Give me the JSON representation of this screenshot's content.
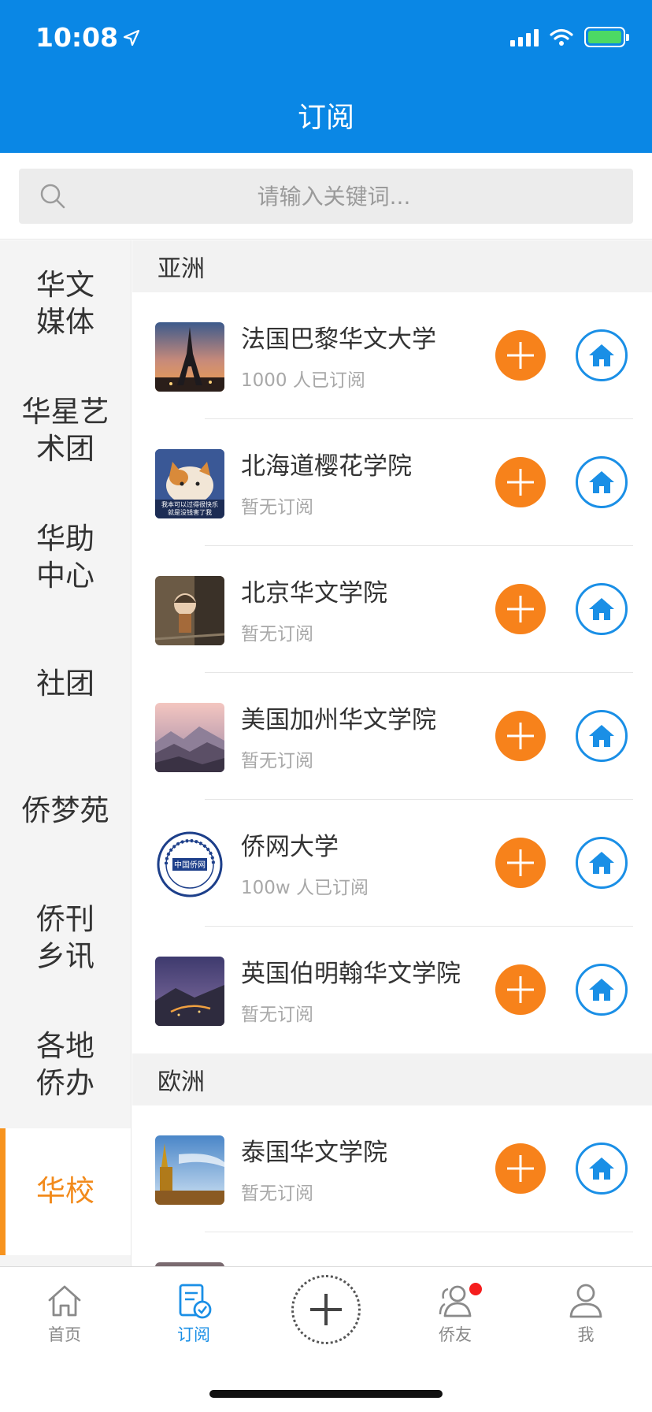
{
  "status_bar": {
    "time": "10:08",
    "accent": "#0a87e5"
  },
  "header": {
    "title": "订阅"
  },
  "search": {
    "placeholder": "请输入关键词..."
  },
  "sidebar": {
    "items": [
      {
        "label": "华文媒体",
        "active": false
      },
      {
        "label": "华星艺术团",
        "active": false
      },
      {
        "label": "华助中心",
        "active": false
      },
      {
        "label": "社团",
        "active": false
      },
      {
        "label": "侨梦苑",
        "active": false
      },
      {
        "label": "侨刊乡讯",
        "active": false
      },
      {
        "label": "各地侨办",
        "active": false
      },
      {
        "label": "华校",
        "active": true
      }
    ]
  },
  "sections": [
    {
      "title": "亚洲",
      "items": [
        {
          "name": "法国巴黎华文大学",
          "subtitle": "1000 人已订阅",
          "thumb": "eiffel-tower-photo"
        },
        {
          "name": "北海道樱花学院",
          "subtitle": "暂无订阅",
          "thumb": "cat-meme-photo",
          "thumb_caption_1": "我本可以过得很快乐",
          "thumb_caption_2": "就是没钱害了我"
        },
        {
          "name": "北京华文学院",
          "subtitle": "暂无订阅",
          "thumb": "figurine-photo"
        },
        {
          "name": "美国加州华文学院",
          "subtitle": "暂无订阅",
          "thumb": "misty-mountains-photo"
        },
        {
          "name": "侨网大学",
          "subtitle": "100w 人已订阅",
          "thumb": "university-seal-logo",
          "logo_text": "中国侨网"
        },
        {
          "name": "英国伯明翰华文学院",
          "subtitle": "暂无订阅",
          "thumb": "night-landscape-photo"
        }
      ]
    },
    {
      "title": "欧洲",
      "items": [
        {
          "name": "泰国华文学院",
          "subtitle": "暂无订阅",
          "thumb": "golden-temple-photo"
        }
      ]
    }
  ],
  "tabbar": {
    "tabs": [
      {
        "label": "首页",
        "icon": "home-icon",
        "active": false
      },
      {
        "label": "订阅",
        "icon": "subscribe-icon",
        "active": true
      },
      {
        "label": "",
        "icon": "plus-icon",
        "active": false
      },
      {
        "label": "侨友",
        "icon": "friends-icon",
        "active": false,
        "badge": true
      },
      {
        "label": "我",
        "icon": "profile-icon",
        "active": false
      }
    ]
  },
  "colors": {
    "primary": "#0a87e5",
    "orange": "#f7821b",
    "active_text": "#f28a1b",
    "tab_active": "#1a8fe6",
    "badge": "#f51d1d"
  }
}
